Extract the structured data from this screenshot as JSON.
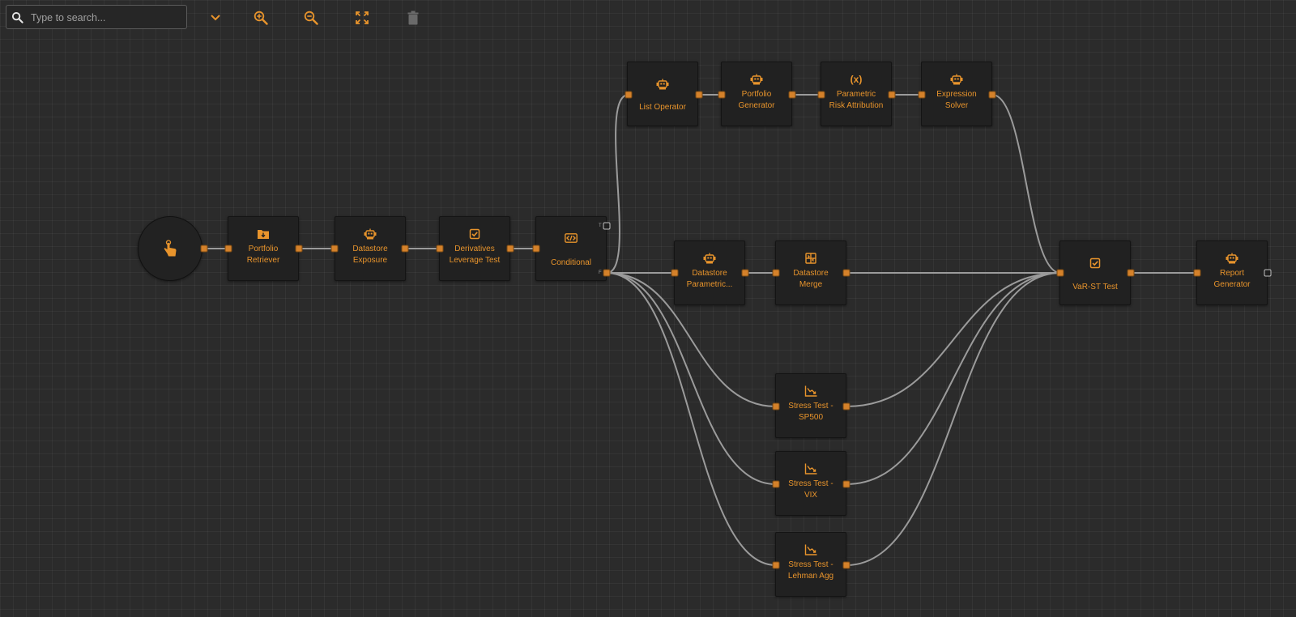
{
  "search": {
    "placeholder": "Type to search...",
    "value": ""
  },
  "toolbar": {
    "buttons": [
      {
        "name": "expand-button",
        "icon": "chevron-down-icon"
      },
      {
        "name": "zoom-in-button",
        "icon": "zoom-in-icon"
      },
      {
        "name": "zoom-out-button",
        "icon": "zoom-out-icon"
      },
      {
        "name": "fit-view-button",
        "icon": "fullscreen-icon"
      },
      {
        "name": "delete-button",
        "icon": "trash-icon",
        "disabled": true
      }
    ]
  },
  "colors": {
    "accent": "#e8942c",
    "background": "#2b2b2b",
    "node": "#212121",
    "edge": "#9b9b9b",
    "disabled": "#6a6a6a"
  },
  "start_node": {
    "icon": "hand-pointer-icon"
  },
  "conditional_ports": {
    "true_label": "T",
    "false_label": "F"
  },
  "nodes": [
    {
      "id": "portfolio-retriever",
      "label": "Portfolio\nRetriever",
      "icon": "folder-download-icon"
    },
    {
      "id": "datastore-exposure",
      "label": "Datastore\nExposure",
      "icon": "robot-icon"
    },
    {
      "id": "derivatives-leverage-test",
      "label": "Derivatives\nLeverage Test",
      "icon": "checkbox-icon"
    },
    {
      "id": "conditional",
      "label": "Conditional",
      "icon": "code-branch-icon"
    },
    {
      "id": "list-operator",
      "label": "List Operator",
      "icon": "robot-icon"
    },
    {
      "id": "portfolio-generator",
      "label": "Portfolio\nGenerator",
      "icon": "robot-icon"
    },
    {
      "id": "parametric-risk-attribution",
      "label": "Parametric\nRisk Attribution",
      "icon": "function-variable-icon",
      "icon_text": "(x)"
    },
    {
      "id": "expression-solver",
      "label": "Expression\nSolver",
      "icon": "robot-icon"
    },
    {
      "id": "datastore-parametric",
      "label": "Datastore\nParametric...",
      "icon": "robot-icon"
    },
    {
      "id": "datastore-merge",
      "label": "Datastore\nMerge",
      "icon": "merge-icon"
    },
    {
      "id": "stress-test-sp500",
      "label": "Stress Test -\nSP500",
      "icon": "chart-line-down-icon"
    },
    {
      "id": "stress-test-vix",
      "label": "Stress Test -\nVIX",
      "icon": "chart-line-down-icon"
    },
    {
      "id": "stress-test-lehman-agg",
      "label": "Stress Test -\nLehman Agg",
      "icon": "chart-line-down-icon"
    },
    {
      "id": "var-st-test",
      "label": "VaR-ST Test",
      "icon": "checkbox-icon"
    },
    {
      "id": "report-generator",
      "label": "Report\nGenerator",
      "icon": "robot-icon"
    }
  ],
  "edges": [
    [
      "start",
      "portfolio-retriever"
    ],
    [
      "portfolio-retriever",
      "datastore-exposure"
    ],
    [
      "datastore-exposure",
      "derivatives-leverage-test"
    ],
    [
      "derivatives-leverage-test",
      "conditional"
    ],
    [
      "conditional",
      "list-operator"
    ],
    [
      "list-operator",
      "portfolio-generator"
    ],
    [
      "portfolio-generator",
      "parametric-risk-attribution"
    ],
    [
      "parametric-risk-attribution",
      "expression-solver"
    ],
    [
      "expression-solver",
      "var-st-test"
    ],
    [
      "conditional",
      "datastore-parametric"
    ],
    [
      "datastore-parametric",
      "datastore-merge"
    ],
    [
      "datastore-merge",
      "var-st-test"
    ],
    [
      "conditional",
      "stress-test-sp500"
    ],
    [
      "conditional",
      "stress-test-vix"
    ],
    [
      "conditional",
      "stress-test-lehman-agg"
    ],
    [
      "stress-test-sp500",
      "var-st-test"
    ],
    [
      "stress-test-vix",
      "var-st-test"
    ],
    [
      "stress-test-lehman-agg",
      "var-st-test"
    ],
    [
      "var-st-test",
      "report-generator"
    ]
  ]
}
